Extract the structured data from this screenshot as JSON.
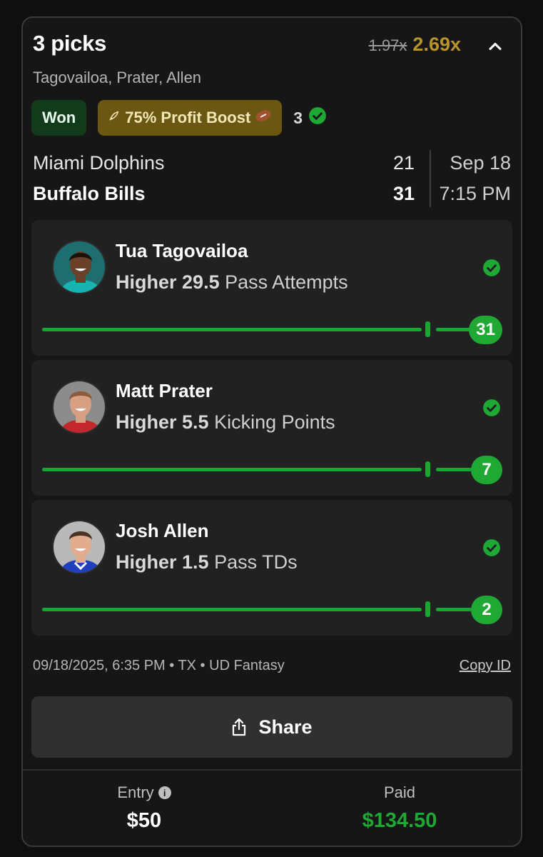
{
  "header": {
    "title": "3 picks",
    "old_multiplier": "1.97x",
    "new_multiplier": "2.69x",
    "players_summary": "Tagovailoa, Prater, Allen"
  },
  "tags": {
    "status": "Won",
    "boost_label": "75% Profit Boost",
    "boost_icon": "rocket-icon",
    "boost_emoji_icon": "football-icon",
    "hits_count": "3"
  },
  "game": {
    "team1": "Miami Dolphins",
    "score1": "21",
    "team2": "Buffalo Bills",
    "score2": "31",
    "date": "Sep 18",
    "time": "7:15 PM"
  },
  "picks": [
    {
      "player": "Tua Tagovailoa",
      "direction": "Higher",
      "line": "29.5",
      "stat": "Pass Attempts",
      "result": "31",
      "jersey_color": "#17b3b0",
      "skin": "#6b4029",
      "hair": "#1c120c",
      "bg": "#1e6d6f"
    },
    {
      "player": "Matt Prater",
      "direction": "Higher",
      "line": "5.5",
      "stat": "Kicking Points",
      "result": "7",
      "jersey_color": "#c1272d",
      "skin": "#d8a083",
      "hair": "#8a5a3a",
      "bg": "#8c8c8c"
    },
    {
      "player": "Josh Allen",
      "direction": "Higher",
      "line": "1.5",
      "stat": "Pass TDs",
      "result": "2",
      "jersey_color": "#1f3fbf",
      "skin": "#e2ad8f",
      "hair": "#4a3322",
      "bg": "#b9b9b9"
    }
  ],
  "footer": {
    "meta": "09/18/2025, 6:35 PM • TX • UD Fantasy",
    "copy_id": "Copy ID",
    "share": "Share",
    "entry_label": "Entry",
    "entry_value": "$50",
    "paid_label": "Paid",
    "paid_value": "$134.50"
  },
  "colors": {
    "accent_green": "#1fa834",
    "boost_gold": "#b8932b",
    "card_bg": "#161616"
  }
}
